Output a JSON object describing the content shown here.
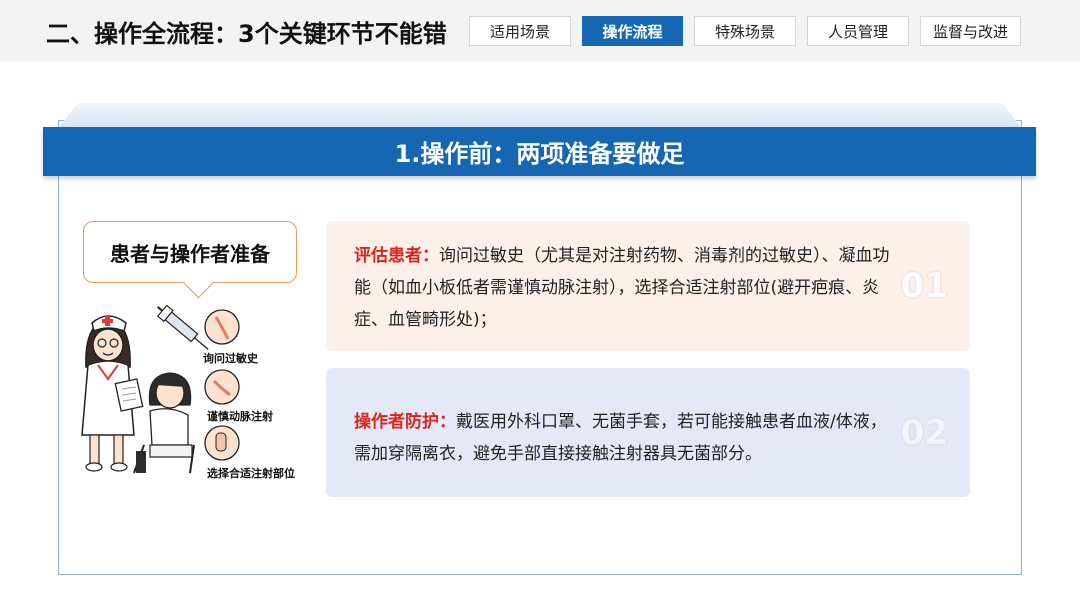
{
  "header": {
    "title": "二、操作全流程：3个关键环节不能错",
    "tabs": [
      {
        "label": "适用场景",
        "active": false
      },
      {
        "label": "操作流程",
        "active": true
      },
      {
        "label": "特殊场景",
        "active": false
      },
      {
        "label": "人员管理",
        "active": false
      },
      {
        "label": "监督与改进",
        "active": false
      }
    ]
  },
  "section": {
    "heading": "1.操作前：两项准备要做足",
    "callout": "患者与操作者准备",
    "illustration": {
      "steps": [
        "询问过敏史",
        "谨慎动脉注射",
        "选择合适注射部位"
      ],
      "icons": [
        "nurse-icon",
        "patient-icon",
        "syringe-icon"
      ]
    },
    "cards": [
      {
        "key": "评估患者：",
        "text": "询问过敏史（尤其是对注射药物、消毒剂的过敏史）、凝血功能（如血小板低者需谨慎动脉注射），选择合适注射部位(避开疤痕、炎症、血管畸形处)；",
        "number": "01"
      },
      {
        "key": "操作者防护：",
        "text": "戴医用外科口罩、无菌手套，若可能接触患者血液/体液，需加穿隔离衣，避免手部直接接触注射器具无菌部分。",
        "number": "02"
      }
    ]
  },
  "colors": {
    "brand_blue": "#1567b3",
    "accent_red": "#d9261c",
    "callout_border": "#e59a5e",
    "card1_bg": "#fdf0e9",
    "card2_bg": "#e5e9f7"
  }
}
